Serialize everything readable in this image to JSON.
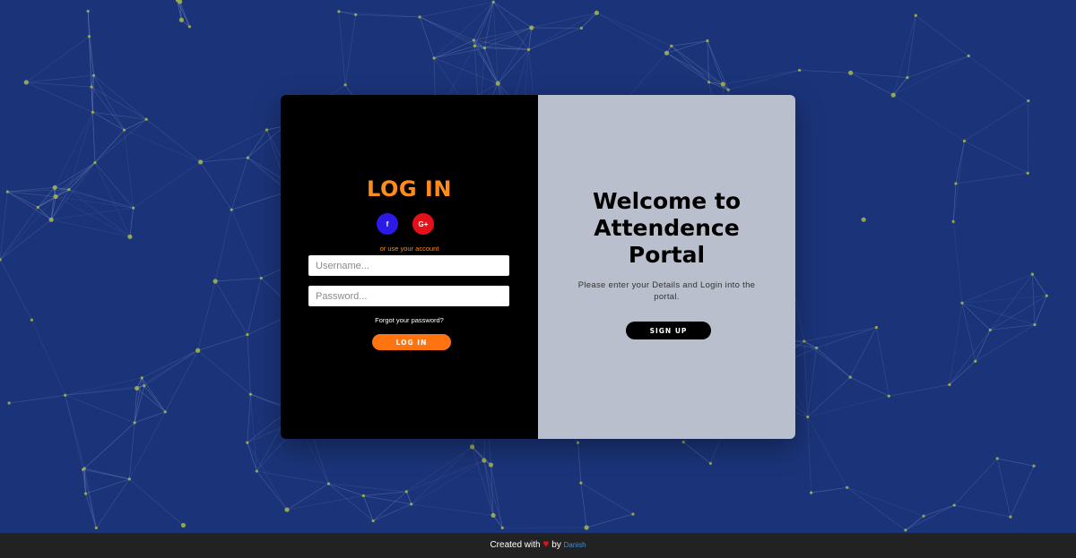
{
  "login": {
    "title": "LOG IN",
    "facebook_glyph": "f",
    "google_glyph": "G+",
    "alt_text": "or use your account",
    "username_placeholder": "Username...",
    "password_placeholder": "Password...",
    "forgot_label": "Forgot your password?",
    "login_button": "LOG IN",
    "accent_color": "#ff8c1a"
  },
  "welcome": {
    "line1": "Welcome to",
    "line2": "Attendence",
    "line3": "Portal",
    "description": "Please enter your Details and Login into the portal.",
    "signup_button": "SIGN UP"
  },
  "footer": {
    "prefix": "Created with",
    "heart": "♥",
    "by": "by",
    "author": "Danish"
  },
  "icons": {
    "facebook": "facebook-icon",
    "google_plus": "google-plus-icon",
    "heart": "heart-icon"
  },
  "colors": {
    "background": "#1b3479",
    "left_panel": "#000000",
    "right_panel": "#babfce",
    "login_button": "#ff7410",
    "facebook": "#2b19e6",
    "google_plus": "#e6101a"
  }
}
